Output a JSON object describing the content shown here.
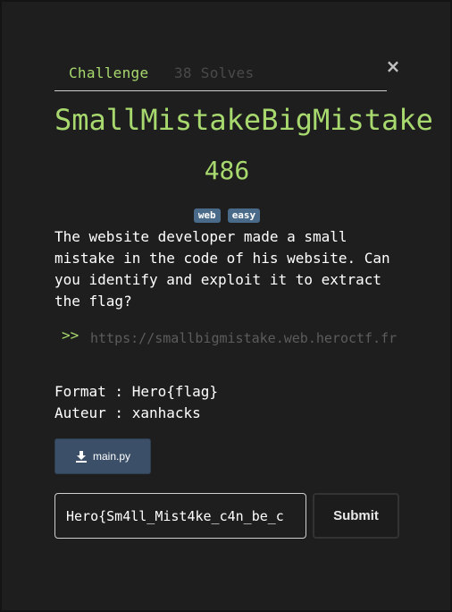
{
  "tabs": {
    "challenge": "Challenge",
    "solves": "38 Solves"
  },
  "close_label": "×",
  "challenge": {
    "title": "SmallMistakeBigMistake",
    "points": "486",
    "tags": [
      "web",
      "easy"
    ],
    "description": "The website developer made a small mistake in the code of his website. Can you identify and exploit it to extract the flag?",
    "link_prefix": ">>",
    "link": "https://smallbigmistake.web.heroctf.fr",
    "format_line": "Format : Hero{flag}",
    "author_line": "Auteur : xanhacks"
  },
  "file": {
    "name": "main.py",
    "icon": "download-icon"
  },
  "submission": {
    "value": "Hero{Sm4ll_Mist4ke_c4n_be_c",
    "submit_label": "Submit"
  },
  "colors": {
    "accent": "#a8d96e",
    "tag": "#4a6a8a",
    "file_button": "#3b5068",
    "background": "#1e1e1e"
  }
}
